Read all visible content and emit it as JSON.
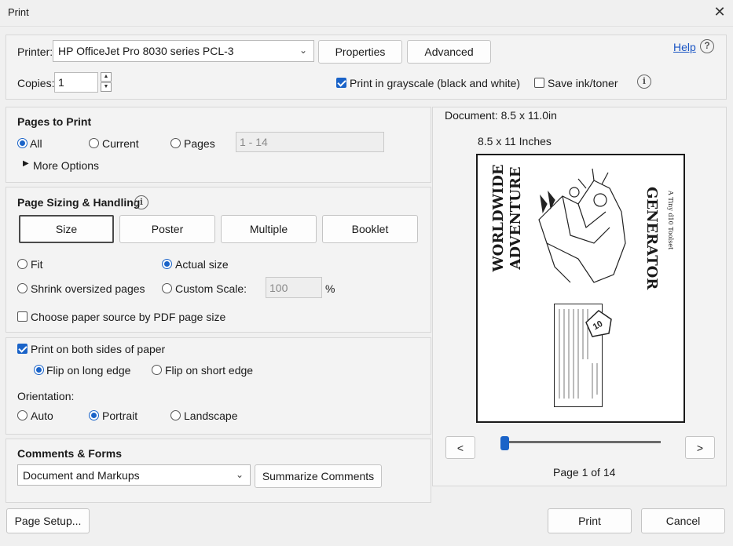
{
  "window": {
    "title": "Print"
  },
  "printer": {
    "label": "Printer:",
    "selected": "HP OfficeJet Pro 8030 series PCL-3",
    "properties_label": "Properties",
    "advanced_label": "Advanced"
  },
  "help": {
    "label": "Help"
  },
  "copies": {
    "label": "Copies:",
    "value": "1"
  },
  "grayscale": {
    "label": "Print in grayscale (black and white)",
    "checked": true
  },
  "save_ink": {
    "label": "Save ink/toner",
    "checked": false
  },
  "pages_to_print": {
    "title": "Pages to Print",
    "all_label": "All",
    "current_label": "Current",
    "pages_label": "Pages",
    "pages_value": "1 - 14",
    "more_options": "More Options"
  },
  "sizing": {
    "title": "Page Sizing & Handling",
    "tabs": [
      "Size",
      "Poster",
      "Multiple",
      "Booklet"
    ],
    "fit_label": "Fit",
    "actual_label": "Actual size",
    "shrink_label": "Shrink oversized pages",
    "custom_label": "Custom Scale:",
    "custom_value": "100",
    "percent": "%",
    "paper_source_label": "Choose paper source by PDF page size"
  },
  "duplex": {
    "both_sides_label": "Print on both sides of paper",
    "long_edge_label": "Flip on long edge",
    "short_edge_label": "Flip on short edge",
    "orientation_label": "Orientation:",
    "auto_label": "Auto",
    "portrait_label": "Portrait",
    "landscape_label": "Landscape"
  },
  "comments": {
    "title": "Comments & Forms",
    "selected": "Document and Markups",
    "summarize_label": "Summarize Comments"
  },
  "preview": {
    "document_label": "Document: 8.5 x 11.0in",
    "size_label": "8.5 x 11 Inches",
    "prev_label": "<",
    "next_label": ">",
    "page_indicator": "Page 1 of 14",
    "page_title_left_1": "WORLDWIDE",
    "page_title_left_2": "ADVENTURE",
    "page_title_right": "GENERATOR",
    "page_subtitle": "A Tiny d10 Toolset",
    "dice_label": "10",
    "current_page": 1,
    "total_pages": 14
  },
  "footer": {
    "page_setup_label": "Page Setup...",
    "print_label": "Print",
    "cancel_label": "Cancel"
  }
}
